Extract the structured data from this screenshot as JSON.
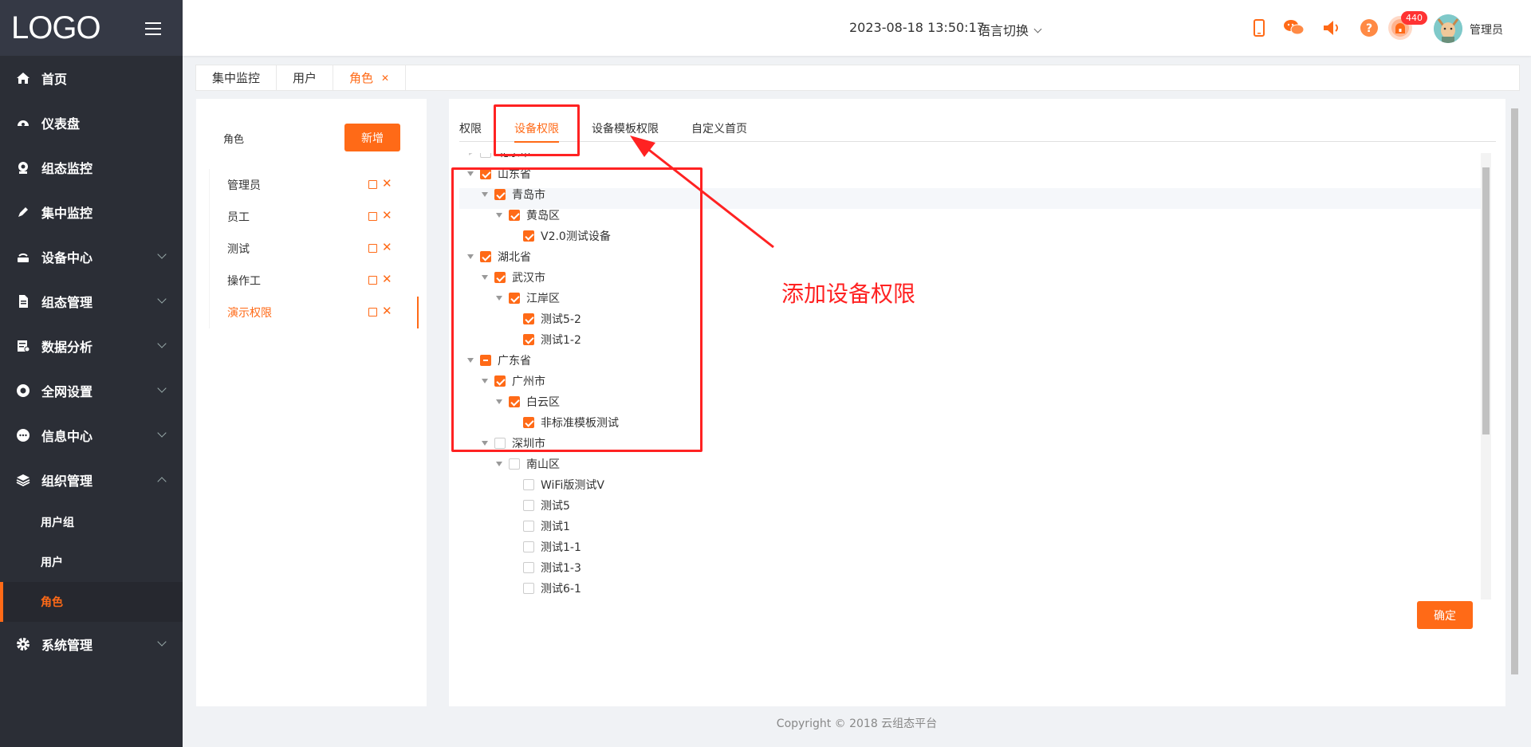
{
  "sidebar": {
    "logo": "LOGO",
    "menu": [
      {
        "label": "首页",
        "icon": "home-icon"
      },
      {
        "label": "仪表盘",
        "icon": "dashboard-icon"
      },
      {
        "label": "组态监控",
        "icon": "webcam-icon"
      },
      {
        "label": "集中监控",
        "icon": "pen-icon"
      },
      {
        "label": "设备中心",
        "icon": "router-icon"
      },
      {
        "label": "组态管理",
        "icon": "document-icon"
      },
      {
        "label": "数据分析",
        "icon": "report-icon"
      },
      {
        "label": "全网设置",
        "icon": "circle-settings-icon"
      },
      {
        "label": "信息中心",
        "icon": "chat-icon"
      },
      {
        "label": "组织管理",
        "icon": "layers-icon"
      }
    ],
    "submenu": [
      "用户组",
      "用户",
      "角色"
    ],
    "last": {
      "label": "系统管理",
      "icon": "gear-icon"
    }
  },
  "header": {
    "datetime": "2023-08-18 13:50:17",
    "language": "语言切换",
    "badge": "440",
    "username": "管理员"
  },
  "tabs": [
    "集中监控",
    "用户",
    "角色"
  ],
  "roles": {
    "title": "角色",
    "add_label": "新增",
    "items": [
      "管理员",
      "员工",
      "测试",
      "操作工",
      "演示权限"
    ]
  },
  "inner_tabs": [
    "权限",
    "设备权限",
    "设备模板权限",
    "自定义首页"
  ],
  "tree": [
    "北京市",
    "山东省",
    "青岛市",
    "黄岛区",
    "V2.0测试设备",
    "湖北省",
    "武汉市",
    "江岸区",
    "测试5-2",
    "测试1-2",
    "广东省",
    "广州市",
    "白云区",
    "非标准模板测试",
    "深圳市",
    "南山区",
    "WiFi版测试V",
    "测试5",
    "测试1",
    "测试1-1",
    "测试1-3",
    "测试6-1"
  ],
  "ok_label": "确定",
  "annotation": "添加设备权限",
  "footer": "Copyright © 2018 云组态平台",
  "colors": {
    "accent": "#ff6a17",
    "sidebar": "#2b2e36",
    "annotation": "#ff2222"
  }
}
